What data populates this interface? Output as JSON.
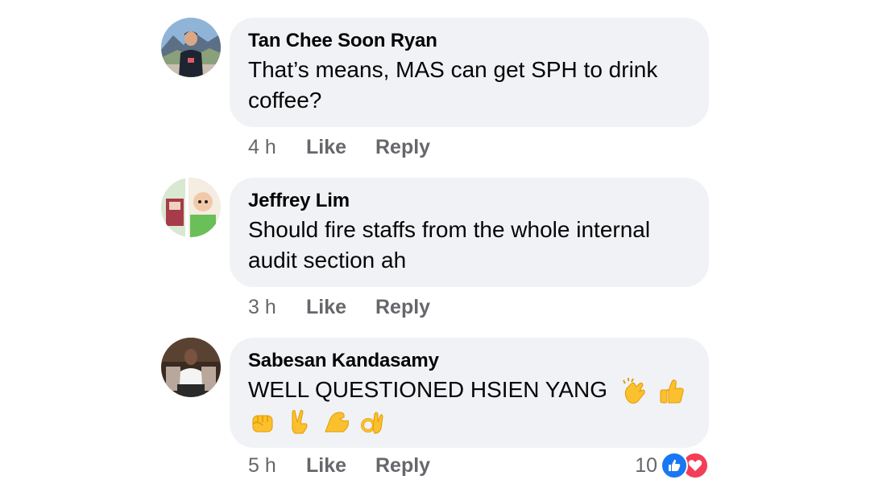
{
  "comments": [
    {
      "author": "Tan Chee Soon Ryan",
      "text": "That’s means, MAS can get SPH to drink coffee?",
      "time": "4 h",
      "like_label": "Like",
      "reply_label": "Reply",
      "avatar_icon": "avatar-photo-mountain-man"
    },
    {
      "author": "Jeffrey Lim",
      "text": "Should fire staffs from the whole internal audit section ah",
      "time": "3 h",
      "like_label": "Like",
      "reply_label": "Reply",
      "avatar_icon": "avatar-cartoon-art"
    },
    {
      "author": "Sabesan Kandasamy",
      "text": "WELL QUESTIONED HSIEN YANG",
      "emojis": [
        "clapping-hands",
        "thumbs-up",
        "raised-fist",
        "victory-hand",
        "flexed-biceps",
        "ok-hand"
      ],
      "time": "5 h",
      "like_label": "Like",
      "reply_label": "Reply",
      "reaction_count": "10",
      "reactions": [
        "like-reaction-icon",
        "love-reaction-icon"
      ],
      "avatar_icon": "avatar-photo-seated-man"
    }
  ],
  "colors": {
    "bubble_bg": "#f0f2f5",
    "meta_text": "#65676b",
    "like_blue": "#1877f2",
    "love_red": "#f33e58"
  }
}
